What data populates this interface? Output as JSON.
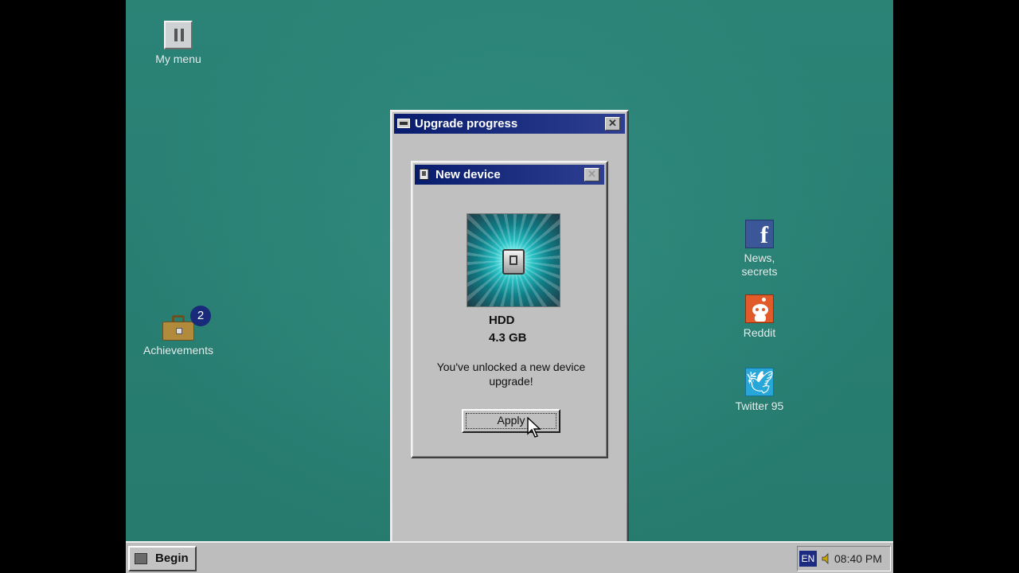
{
  "desktop": {
    "icons": [
      {
        "label": "My menu"
      },
      {
        "label": "Achievements",
        "badge": "2"
      },
      {
        "label": "News,\nsecrets",
        "icon": "facebook-icon"
      },
      {
        "label": "Reddit",
        "icon": "reddit-icon"
      },
      {
        "label": "Twitter 95",
        "icon": "twitter-icon"
      }
    ]
  },
  "upgrade_window": {
    "title": "Upgrade progress"
  },
  "device_window": {
    "title": "New device",
    "device_name": "HDD",
    "device_size": "4.3 GB",
    "message": "You've unlocked a new device upgrade!",
    "apply_label": "Apply"
  },
  "taskbar": {
    "start_label": "Begin",
    "language": "EN",
    "clock": "08:40 PM"
  },
  "colors": {
    "desktop": "#2f8a7d",
    "titlebar": "#081c6e",
    "window": "#c0c0c0"
  }
}
